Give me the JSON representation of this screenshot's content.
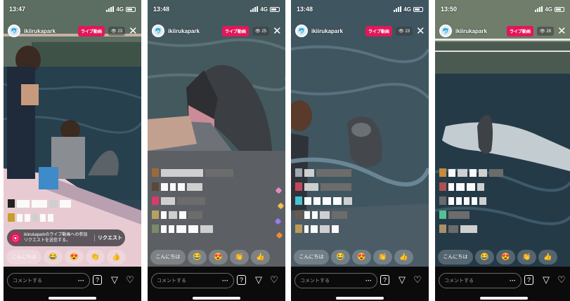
{
  "screens": [
    {
      "time": "13:47",
      "username": "ikiirukapark",
      "live_badge": "ライブ動画",
      "viewer_count": "23",
      "request_text": "ikiirukaparkのライブ動画への参加リクエストを送信する。",
      "request_button": "リクエスト"
    },
    {
      "time": "13:48",
      "username": "ikiirukapark",
      "live_badge": "ライブ動画",
      "viewer_count": "25"
    },
    {
      "time": "13:48",
      "username": "ikiirukapark",
      "live_badge": "ライブ動画",
      "viewer_count": "23"
    },
    {
      "time": "13:50",
      "username": "ikiirukapark",
      "live_badge": "ライブ動画",
      "viewer_count": "28"
    }
  ],
  "status": {
    "network": "4G"
  },
  "quick_reply_text": "こんにちは",
  "quick_reactions": [
    "😂",
    "😍",
    "👏",
    "👍"
  ],
  "comment_placeholder": "コメントする",
  "comment_more": "···",
  "icons": {
    "avatar": "dolphin-logo-icon",
    "close": "close-icon",
    "question": "question-icon",
    "send": "paper-plane-icon",
    "like": "heart-icon",
    "request": "join-request-icon"
  },
  "colors": {
    "live": "#e2175a",
    "water": "#2c4250"
  }
}
